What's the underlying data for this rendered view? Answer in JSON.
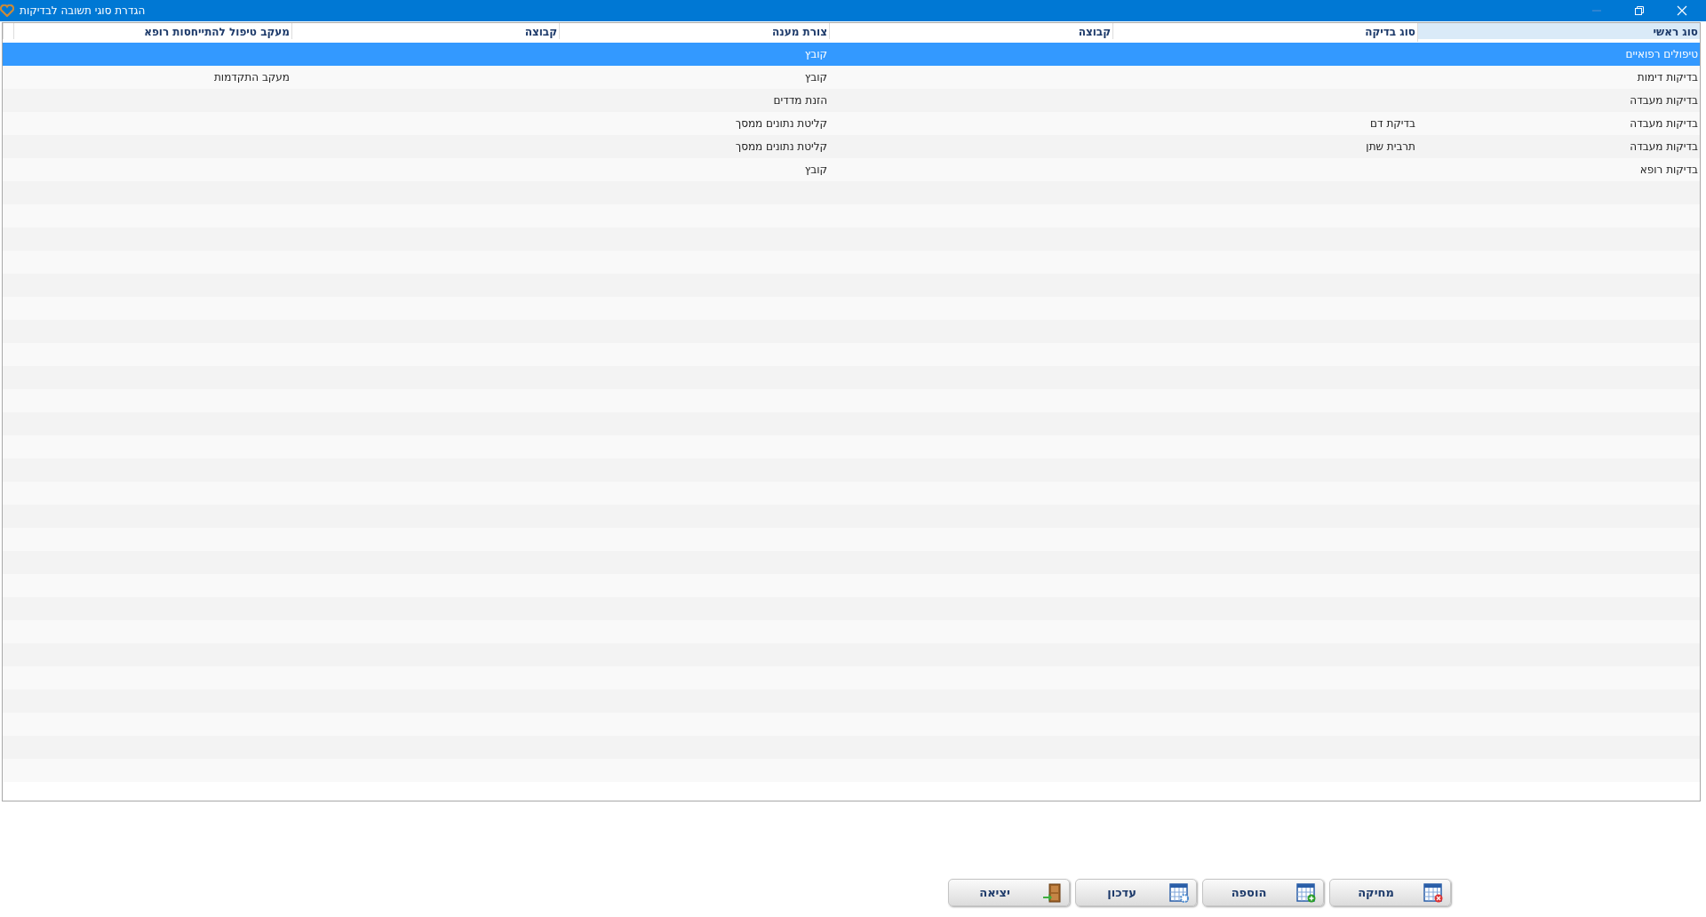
{
  "window": {
    "title": "הגדרת סוגי תשובה לבדיקות"
  },
  "table": {
    "columns": [
      {
        "label": "סוג ראשי",
        "sorted": true
      },
      {
        "label": "סוג בדיקה",
        "sorted": false
      },
      {
        "label": "קבוצה",
        "sorted": false
      },
      {
        "label": "צורת מענה",
        "sorted": false
      },
      {
        "label": "קבוצה",
        "sorted": false
      },
      {
        "label": "מעקב טיפול להתייחסות רופא",
        "sorted": false
      }
    ],
    "rows": [
      {
        "selected": true,
        "cells": [
          "טיפולים רפואיים",
          "",
          "",
          "קובץ",
          "",
          ""
        ]
      },
      {
        "selected": false,
        "cells": [
          "בדיקות דימות",
          "",
          "",
          "קובץ",
          "",
          "מעקב התקדמות"
        ]
      },
      {
        "selected": false,
        "cells": [
          "בדיקות מעבדה",
          "",
          "",
          "הזנת מדדים",
          "",
          ""
        ]
      },
      {
        "selected": false,
        "cells": [
          "בדיקות מעבדה",
          "בדיקת דם",
          "",
          "קליטת נתונים ממסך",
          "",
          ""
        ]
      },
      {
        "selected": false,
        "cells": [
          "בדיקות מעבדה",
          "תרבית שתן",
          "",
          "קליטת נתונים ממסך",
          "",
          ""
        ]
      },
      {
        "selected": false,
        "cells": [
          "בדיקות רופא",
          "",
          "",
          "קובץ",
          "",
          ""
        ]
      }
    ]
  },
  "buttons": [
    {
      "label": "מחיקה",
      "kind": "delete"
    },
    {
      "label": "הוספה",
      "kind": "add"
    },
    {
      "label": "עדכון",
      "kind": "update"
    },
    {
      "label": "יציאה",
      "kind": "exit"
    }
  ]
}
